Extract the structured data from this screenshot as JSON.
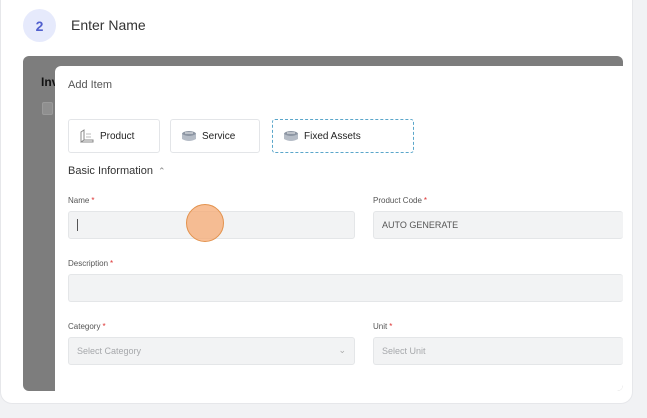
{
  "step": {
    "number": "2",
    "title": "Enter Name"
  },
  "background": {
    "label": "Inv"
  },
  "modal": {
    "title": "Add Item",
    "item_types": [
      {
        "label": "Product",
        "icon": "product-icon",
        "selected": false
      },
      {
        "label": "Service",
        "icon": "service-box-icon",
        "selected": false
      },
      {
        "label": "Fixed Assets",
        "icon": "fixed-assets-box-icon",
        "selected": true
      }
    ],
    "section": {
      "title": "Basic Information",
      "expanded": true
    },
    "fields": {
      "name": {
        "label": "Name",
        "required": "*",
        "value": ""
      },
      "product_code": {
        "label": "Product Code",
        "required": "*",
        "value": "AUTO GENERATE"
      },
      "description": {
        "label": "Description",
        "required": "*",
        "value": ""
      },
      "category": {
        "label": "Category",
        "required": "*",
        "placeholder": "Select Category"
      },
      "unit": {
        "label": "Unit",
        "required": "*",
        "placeholder": "Select Unit"
      }
    }
  },
  "colors": {
    "accent": "#5160ce",
    "selected_border": "#5aa6ca",
    "required": "#dd3333",
    "click_marker": "#f5a66e"
  }
}
